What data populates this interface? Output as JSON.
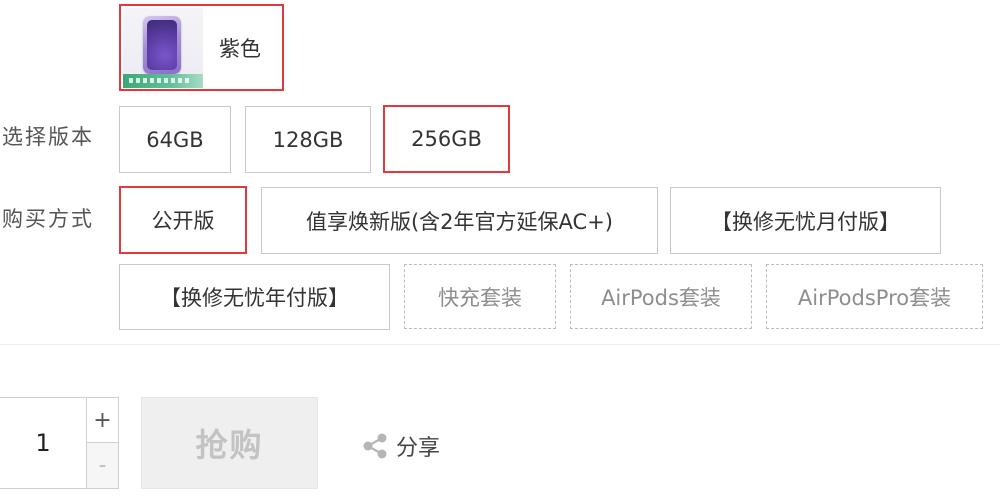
{
  "color": {
    "option_label": "紫色",
    "selected": true
  },
  "version": {
    "label": "选择版本",
    "options": [
      "64GB",
      "128GB",
      "256GB"
    ],
    "selected": "256GB"
  },
  "purchase": {
    "label": "购买方式",
    "options": [
      "公开版",
      "值享焕新版(含2年官方延保AC+)",
      "【换修无忧月付版】",
      "【换修无忧年付版】",
      "快充套装",
      "AirPods套装",
      "AirPodsPro套装"
    ],
    "selected": "公开版",
    "unavailable": [
      "快充套装",
      "AirPods套装",
      "AirPodsPro套装"
    ]
  },
  "quantity": {
    "value": "1",
    "plus_label": "+",
    "minus_label": "-"
  },
  "buy_button": {
    "label": "抢购",
    "enabled": false
  },
  "share": {
    "label": "分享",
    "icon": "share-icon"
  },
  "colors": {
    "accent": "#e4393c",
    "border": "#c9c9c9",
    "disabled": "#c3c3c3"
  }
}
